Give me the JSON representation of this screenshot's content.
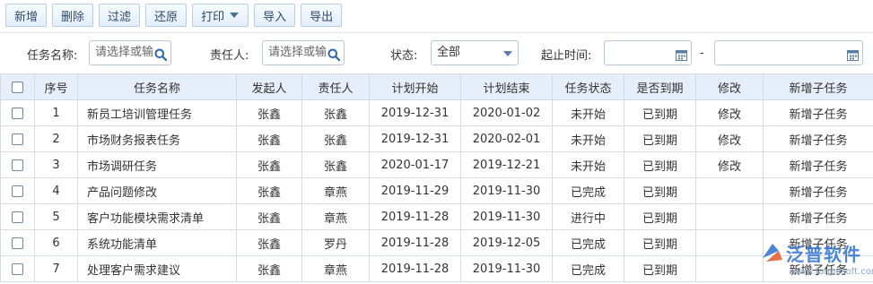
{
  "toolbar": {
    "add_label": "新增",
    "delete_label": "删除",
    "filter_label": "过滤",
    "restore_label": "还原",
    "print_label": "打印",
    "import_label": "导入",
    "export_label": "导出"
  },
  "filters": {
    "task_name_label": "任务名称:",
    "task_name_placeholder": "请选择或输",
    "assignee_label": "责任人:",
    "assignee_placeholder": "请选择或输",
    "status_label": "状态:",
    "status_value": "全部",
    "date_range_label": "起止时间:",
    "date_separator": "-"
  },
  "table": {
    "headers": [
      "序号",
      "任务名称",
      "发起人",
      "责任人",
      "计划开始",
      "计划结束",
      "任务状态",
      "是否到期",
      "修改",
      "新增子任务"
    ],
    "rows": [
      {
        "no": "1",
        "name": "新员工培训管理任务",
        "initiator": "张鑫",
        "assignee": "张鑫",
        "start": "2019-12-31",
        "end": "2020-01-02",
        "status": "未开始",
        "due": "已到期",
        "edit": "修改",
        "add_sub": "新增子任务"
      },
      {
        "no": "2",
        "name": "市场财务报表任务",
        "initiator": "张鑫",
        "assignee": "张鑫",
        "start": "2019-12-31",
        "end": "2020-02-01",
        "status": "未开始",
        "due": "已到期",
        "edit": "修改",
        "add_sub": "新增子任务"
      },
      {
        "no": "3",
        "name": "市场调研任务",
        "initiator": "张鑫",
        "assignee": "张鑫",
        "start": "2020-01-17",
        "end": "2019-12-21",
        "status": "未开始",
        "due": "已到期",
        "edit": "修改",
        "add_sub": "新增子任务"
      },
      {
        "no": "4",
        "name": "产品问题修改",
        "initiator": "张鑫",
        "assignee": "章燕",
        "start": "2019-11-29",
        "end": "2019-11-30",
        "status": "已完成",
        "due": "已到期",
        "edit": "",
        "add_sub": "新增子任务"
      },
      {
        "no": "5",
        "name": "客户功能模块需求清单",
        "initiator": "张鑫",
        "assignee": "章燕",
        "start": "2019-11-28",
        "end": "2019-11-30",
        "status": "进行中",
        "due": "已到期",
        "edit": "",
        "add_sub": "新增子任务"
      },
      {
        "no": "6",
        "name": "系统功能清单",
        "initiator": "张鑫",
        "assignee": "罗丹",
        "start": "2019-11-28",
        "end": "2019-12-05",
        "status": "已完成",
        "due": "已到期",
        "edit": "",
        "add_sub": "新增子任务"
      },
      {
        "no": "7",
        "name": "处理客户需求建议",
        "initiator": "张鑫",
        "assignee": "章燕",
        "start": "2019-11-28",
        "end": "2019-11-30",
        "status": "已完成",
        "due": "已到期",
        "edit": "",
        "add_sub": "新增子任务"
      }
    ]
  },
  "watermark": {
    "brand": "泛普软件",
    "url": "www.fanpusoft.com"
  },
  "colors": {
    "link": "#1a5fb4",
    "header_bg": "#e6eff9",
    "button_border": "#b7cde4",
    "brand": "#2d6fd1"
  },
  "icons": {
    "search": "search-icon",
    "calendar": "calendar-icon",
    "dropdown": "chevron-down-icon",
    "logo": "fanpu-logo"
  }
}
